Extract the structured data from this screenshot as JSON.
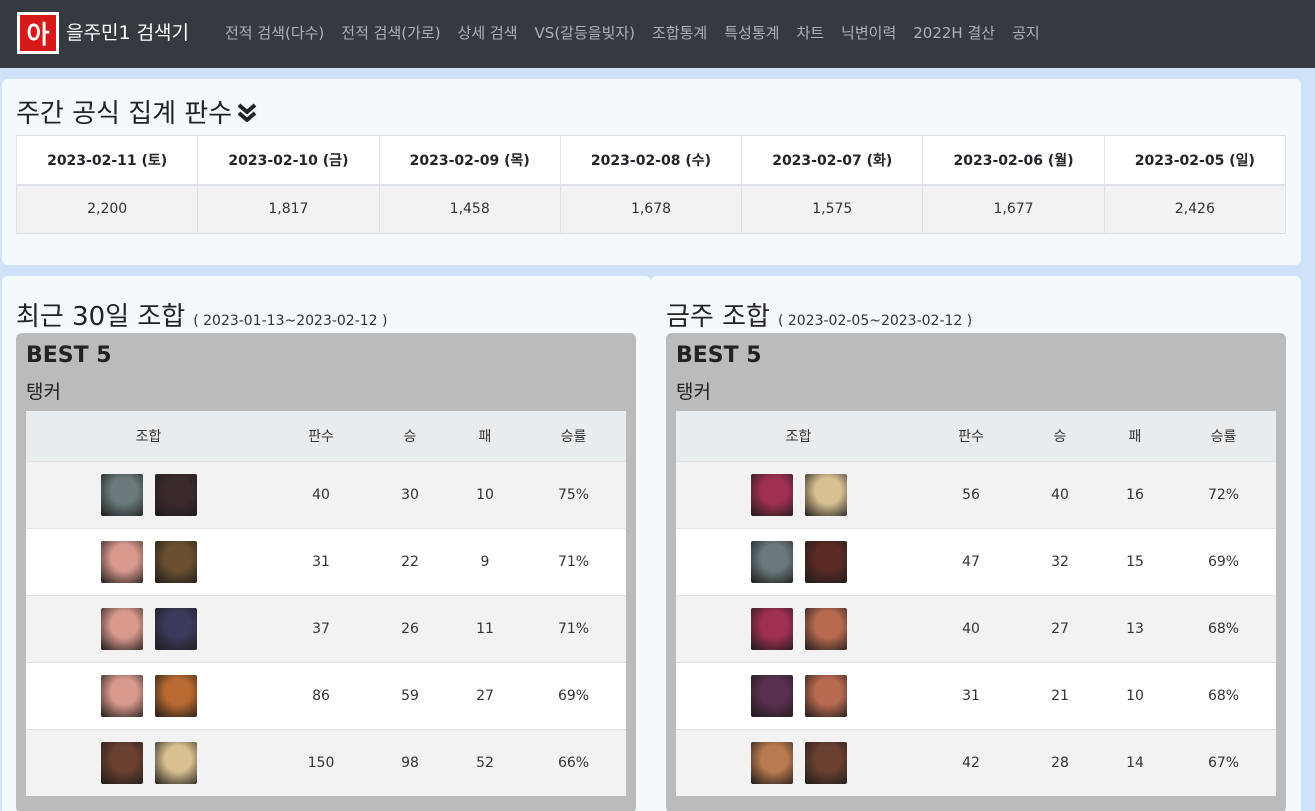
{
  "brand": {
    "logo_char": "아",
    "name": "을주민1 검색기"
  },
  "nav": [
    {
      "label": "전적 검색(다수)"
    },
    {
      "label": "전적 검색(가로)"
    },
    {
      "label": "상세 검색"
    },
    {
      "label": "VS(갈등을빚자)"
    },
    {
      "label": "조합통계"
    },
    {
      "label": "특성통계"
    },
    {
      "label": "차트"
    },
    {
      "label": "닉변이력"
    },
    {
      "label": "2022H 결산"
    },
    {
      "label": "공지"
    }
  ],
  "weekly": {
    "title": "주간 공식 집계 판수",
    "icon": "double-chevron-down-icon",
    "dates": [
      "2023-02-11 (토)",
      "2023-02-10 (금)",
      "2023-02-09 (목)",
      "2023-02-08 (수)",
      "2023-02-07 (화)",
      "2023-02-06 (월)",
      "2023-02-05 (일)"
    ],
    "counts": [
      "2,200",
      "1,817",
      "1,458",
      "1,678",
      "1,575",
      "1,677",
      "2,426"
    ]
  },
  "columns": {
    "combo": "조합",
    "games": "판수",
    "wins": "승",
    "losses": "패",
    "rate": "승률"
  },
  "recent": {
    "title": "최근 30일 조합",
    "range": "( 2023-01-13~2023-02-12 )",
    "best_title": "BEST 5",
    "role": "탱커",
    "rows": [
      {
        "p1": "#6a7a7c",
        "p2": "#3a2a2c",
        "games": "40",
        "wins": "30",
        "losses": "10",
        "rate": "75%"
      },
      {
        "p1": "#d99a8e",
        "p2": "#6a5030",
        "games": "31",
        "wins": "22",
        "losses": "9",
        "rate": "71%"
      },
      {
        "p1": "#d99a8e",
        "p2": "#3a3a5a",
        "games": "37",
        "wins": "26",
        "losses": "11",
        "rate": "71%"
      },
      {
        "p1": "#d99a8e",
        "p2": "#b86a30",
        "games": "86",
        "wins": "59",
        "losses": "27",
        "rate": "69%"
      },
      {
        "p1": "#6a4030",
        "p2": "#d8c090",
        "games": "150",
        "wins": "98",
        "losses": "52",
        "rate": "66%"
      }
    ]
  },
  "week": {
    "title": "금주 조합",
    "range": "( 2023-02-05~2023-02-12 )",
    "best_title": "BEST 5",
    "role": "탱커",
    "rows": [
      {
        "p1": "#a03050",
        "p2": "#d8c090",
        "games": "56",
        "wins": "40",
        "losses": "16",
        "rate": "72%"
      },
      {
        "p1": "#6a7a7c",
        "p2": "#5a2a24",
        "games": "47",
        "wins": "32",
        "losses": "15",
        "rate": "69%"
      },
      {
        "p1": "#a03050",
        "p2": "#b86a50",
        "games": "40",
        "wins": "27",
        "losses": "13",
        "rate": "68%"
      },
      {
        "p1": "#5a3050",
        "p2": "#b86a50",
        "games": "31",
        "wins": "21",
        "losses": "10",
        "rate": "68%"
      },
      {
        "p1": "#b87a50",
        "p2": "#6a4030",
        "games": "42",
        "wins": "28",
        "losses": "14",
        "rate": "67%"
      }
    ]
  }
}
